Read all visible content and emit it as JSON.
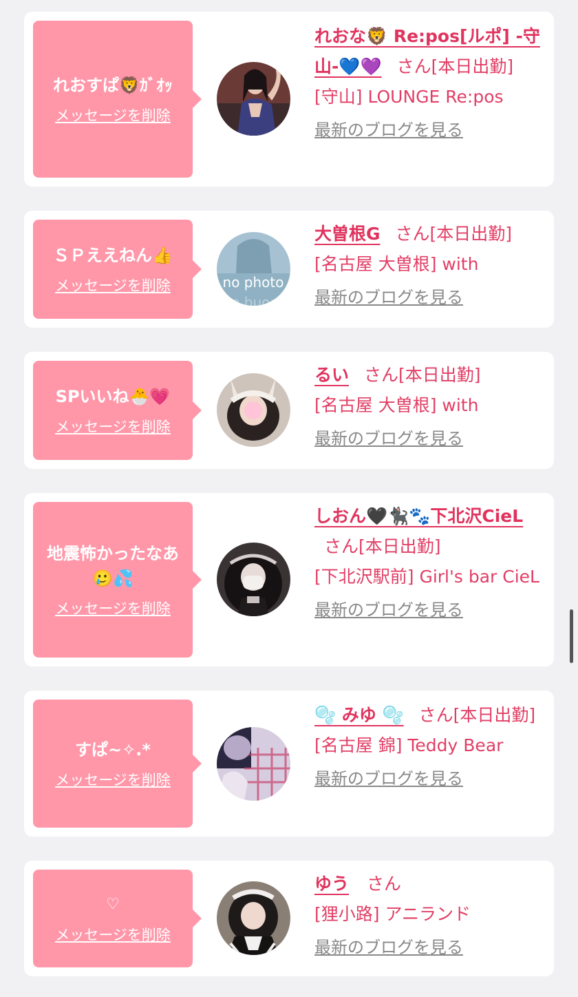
{
  "delete_label": "メッセージを削除",
  "blog_label": "最新のブログを見る",
  "san_suffix": "さん",
  "colors": {
    "accent": "#e23e65",
    "bubble": "#ff97a9",
    "background": "#f1f1f3"
  },
  "cards": [
    {
      "message": "れおすぱ🦁ｶﾞｵｯ",
      "name": "れおな🦁 Re:pos[ルポ] -守山-💙💜",
      "status": "[本日出勤]",
      "shop": "[守山] LOUNGE Re:pos",
      "avatar_icon": "woman-photo-icon"
    },
    {
      "message": "ＳＰええねん👍",
      "name": "大曽根G",
      "status": "[本日出勤]",
      "shop": "[名古屋 大曽根] with",
      "avatar_text": "no photo",
      "avatar_icon": "no-photo-icon"
    },
    {
      "message": "SPいいね🐣💗",
      "name": "るい",
      "status": "[本日出勤]",
      "shop": "[名古屋 大曽根] with",
      "avatar_icon": "bunny-ears-photo-icon"
    },
    {
      "message": "地震怖かったなあ🥲💦",
      "name": "しおん🖤🐈‍⬛🐾下北沢CieL",
      "status": "[本日出勤]",
      "shop": "[下北沢駅前] Girl's bar CieL",
      "avatar_icon": "gothic-photo-icon"
    },
    {
      "message": "すぱ~✧.*",
      "name": "🫧 みゆ 🫧",
      "status": "[本日出勤]",
      "shop": "[名古屋 錦] Teddy Bear",
      "avatar_icon": "pink-plaid-photo-icon"
    },
    {
      "message": "♡",
      "name": "ゆう",
      "status": "",
      "shop": "[狸小路] アニランド",
      "avatar_icon": "maid-photo-icon"
    }
  ]
}
